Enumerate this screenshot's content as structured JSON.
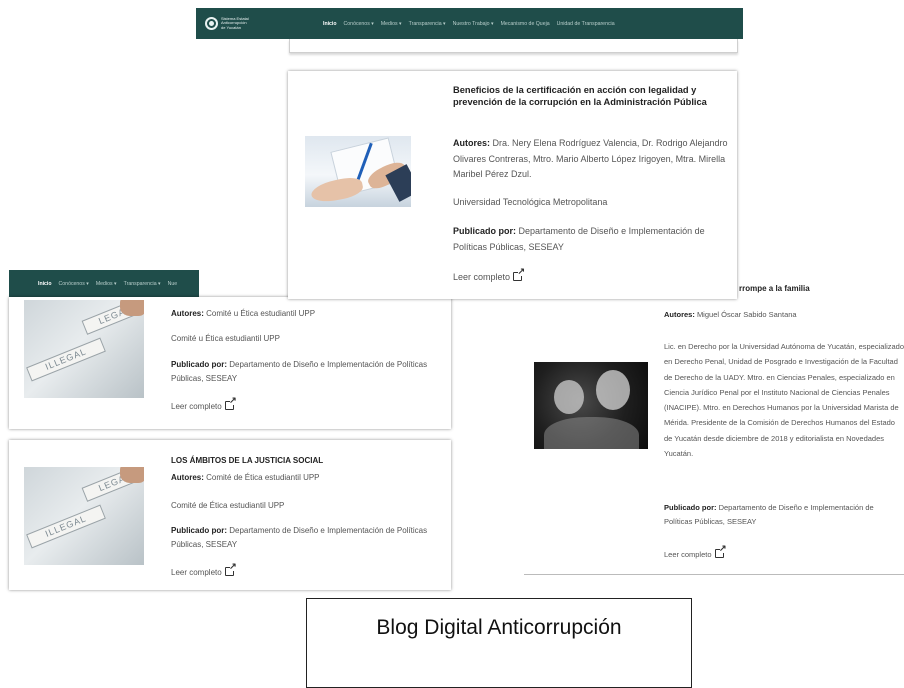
{
  "top_nav": {
    "logo_text": [
      "Sistema Estatal",
      "Anticorrupción",
      "de Yucatán"
    ],
    "items": [
      {
        "label": "Inicio",
        "active": true
      },
      {
        "label": "Conócenos ▾"
      },
      {
        "label": "Medios ▾"
      },
      {
        "label": "Transparencia ▾"
      },
      {
        "label": "Nuestro Trabajo ▾"
      },
      {
        "label": "Mecanismo de Queja"
      },
      {
        "label": "Unidad de Transparencia"
      }
    ]
  },
  "left_nav": {
    "items": [
      {
        "label": "Inicio",
        "active": true
      },
      {
        "label": "Conócenos ▾"
      },
      {
        "label": "Medios ▾"
      },
      {
        "label": "Transparencia ▾"
      },
      {
        "label": "Nue"
      }
    ]
  },
  "card_top": {
    "title": "Beneficios de la certificación en acción con legalidad y prevención de la corrupción en la Administración Pública",
    "authors_label": "Autores:",
    "authors": "Dra. Nery Elena Rodríguez Valencia, Dr. Rodrigo Alejandro Olivares Contreras, Mtro. Mario Alberto López Irigoyen, Mtra. Mirella Maribel Pérez Dzul.",
    "institution": "Universidad Tecnológica Metropolitana",
    "published_label": "Publicado por:",
    "published": "Departamento de Diseño e Implementación de Políticas Públicas, SESEAY",
    "read_more": "Leer completo"
  },
  "card_left1": {
    "authors_label": "Autores:",
    "authors": "Comité u Ética estudiantil UPP",
    "institution": "Comité u Ética estudiantil UPP",
    "published_label": "Publicado por:",
    "published": "Departamento de Diseño e Implementación de Políticas Públicas, SESEAY",
    "read_more": "Leer completo",
    "thumb_words": [
      "LEGAL",
      "ILLEGAL"
    ]
  },
  "card_left2": {
    "title": "LOS ÁMBITOS DE LA JUSTICIA SOCIAL",
    "authors_label": "Autores:",
    "authors": "Comité de Ética estudiantil UPP",
    "institution": "Comité de Ética estudiantil UPP",
    "published_label": "Publicado por:",
    "published": "Departamento de Diseño e Implementación de Políticas Públicas, SESEAY",
    "read_more": "Leer completo",
    "thumb_words": [
      "LEGAL",
      "ILLEGAL"
    ]
  },
  "card_right": {
    "title": "rrompe a la familia",
    "authors_label": "Autores:",
    "authors": "Miguel Óscar Sabido Santana",
    "bio": "Lic. en Derecho por la Universidad Autónoma de Yucatán, especializado en Derecho Penal, Unidad de Posgrado e Investigación de la Facultad de Derecho de la UADY. Mtro. en Ciencias Penales, especializado en Ciencia Jurídico Penal por el Instituto Nacional de Ciencias Penales (INACIPE). Mtro. en Derechos Humanos por la Universidad Marista de Mérida. Presidente de la Comisión de Derechos Humanos del Estado de Yucatán desde diciembre de 2018 y editorialista en Novedades Yucatán.",
    "published_label": "Publicado por:",
    "published": "Departamento de Diseño e Implementación de Políticas Públicas, SESEAY",
    "read_more": "Leer completo"
  },
  "caption": "Blog Digital Anticorrupción"
}
